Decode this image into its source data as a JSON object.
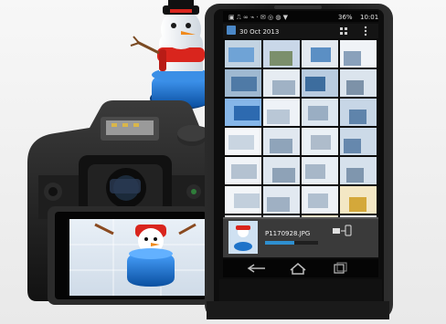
{
  "phone": {
    "status_bar": {
      "signal_percent": "36%",
      "time": "10:01"
    },
    "gallery": {
      "date_label": "30 Oct 2013",
      "thumbnail_count": 28
    },
    "transfer": {
      "filename": "P1170928.JPG",
      "progress": 0.55
    },
    "nav": {
      "icons": [
        "back-icon",
        "home-icon",
        "recents-icon"
      ]
    }
  },
  "camera": {
    "lcd_subject": "snowman figurine on blue base"
  },
  "colors": {
    "phone_body": "#1b1b1b",
    "screen_bg": "#0d0d0d",
    "progress_fill": "#2e8fd0",
    "snowman_red": "#d9251d",
    "snowman_blue": "#1e73c9"
  }
}
